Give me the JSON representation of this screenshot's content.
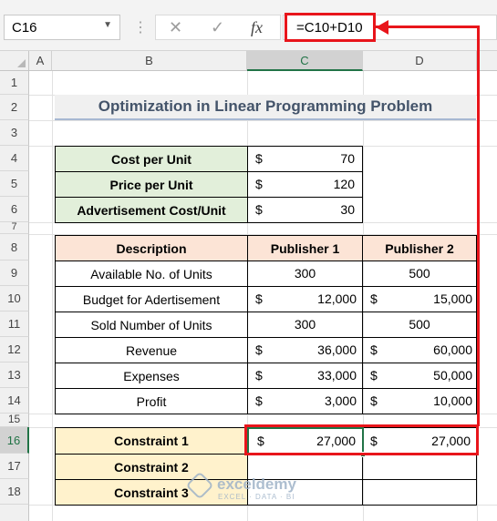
{
  "formula_bar": {
    "name_box": "C16",
    "cancel_icon": "✕",
    "enter_icon": "✓",
    "fx_label": "fx",
    "formula": "=C10+D10"
  },
  "columns": [
    "A",
    "B",
    "C",
    "D"
  ],
  "rows": [
    "1",
    "2",
    "3",
    "4",
    "5",
    "6",
    "7",
    "8",
    "9",
    "10",
    "11",
    "12",
    "13",
    "14",
    "15",
    "16",
    "17",
    "18"
  ],
  "title": "Optimization in Linear Programming Problem",
  "inputs": [
    {
      "label": "Cost per Unit",
      "currency": "$",
      "value": "70"
    },
    {
      "label": "Price per Unit",
      "currency": "$",
      "value": "120"
    },
    {
      "label": "Advertisement Cost/Unit",
      "currency": "$",
      "value": "30"
    }
  ],
  "table": {
    "headers": [
      "Description",
      "Publisher 1",
      "Publisher 2"
    ],
    "rows": [
      {
        "label": "Available No. of Units",
        "c_cur": "",
        "c": "300",
        "d_cur": "",
        "d": "500"
      },
      {
        "label": "Budget for Adertisement",
        "c_cur": "$",
        "c": "12,000",
        "d_cur": "$",
        "d": "15,000"
      },
      {
        "label": "Sold Number of Units",
        "c_cur": "",
        "c": "300",
        "d_cur": "",
        "d": "500"
      },
      {
        "label": "Revenue",
        "c_cur": "$",
        "c": "36,000",
        "d_cur": "$",
        "d": "60,000"
      },
      {
        "label": "Expenses",
        "c_cur": "$",
        "c": "33,000",
        "d_cur": "$",
        "d": "50,000"
      },
      {
        "label": "Profit",
        "c_cur": "$",
        "c": "3,000",
        "d_cur": "$",
        "d": "10,000"
      }
    ]
  },
  "constraints": [
    {
      "label": "Constraint 1",
      "c_cur": "$",
      "c": "27,000",
      "d_cur": "$",
      "d": "27,000"
    },
    {
      "label": "Constraint 2",
      "c_cur": "",
      "c": "",
      "d_cur": "",
      "d": ""
    },
    {
      "label": "Constraint 3",
      "c_cur": "",
      "c": "",
      "d_cur": "",
      "d": ""
    }
  ],
  "watermark": {
    "name": "exceldemy",
    "tagline": "EXCEL · DATA · BI"
  },
  "colors": {
    "highlight": "#e8151b",
    "selection": "#217346",
    "title_text": "#44546a"
  }
}
